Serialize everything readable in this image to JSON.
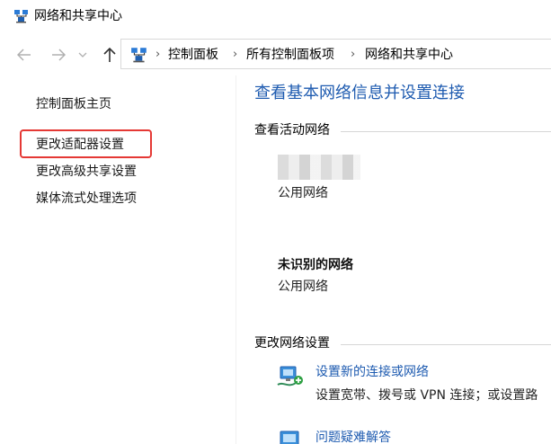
{
  "window": {
    "title": "网络和共享中心"
  },
  "address_bar": {
    "breadcrumbs": [
      "控制面板",
      "所有控制面板项",
      "网络和共享中心"
    ],
    "separator": "›"
  },
  "sidebar": {
    "items": [
      {
        "label": "控制面板主页"
      },
      {
        "label": "更改适配器设置"
      },
      {
        "label": "更改高级共享设置"
      },
      {
        "label": "媒体流式处理选项"
      }
    ]
  },
  "main": {
    "title": "查看基本网络信息并设置连接",
    "active_networks_heading": "查看活动网络",
    "networks": [
      {
        "name": "",
        "type": "公用网络"
      },
      {
        "name": "未识别的网络",
        "type": "公用网络"
      }
    ],
    "change_settings_heading": "更改网络设置",
    "tasks": [
      {
        "link": "设置新的连接或网络",
        "desc": "设置宽带、拨号或 VPN 连接；或设置路"
      },
      {
        "link": "问题疑难解答",
        "desc": ""
      }
    ]
  },
  "colors": {
    "link": "#1e5bb0",
    "highlight": "#e53935"
  }
}
